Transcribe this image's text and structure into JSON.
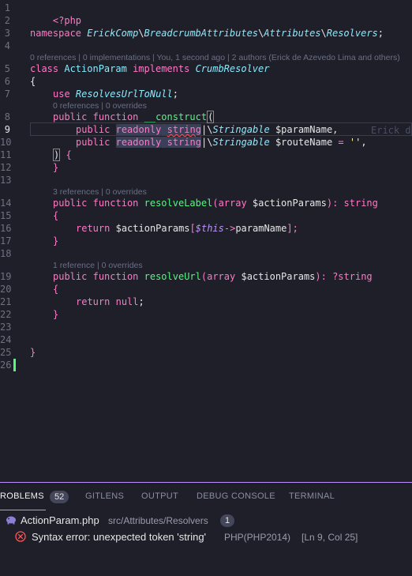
{
  "editor": {
    "active_line": "9",
    "line_numbers": [
      "1",
      "2",
      "3",
      "4",
      "5",
      "6",
      "7",
      "8",
      "9",
      "10",
      "11",
      "12",
      "13",
      "14",
      "15",
      "16",
      "17",
      "18",
      "19",
      "20",
      "21",
      "22",
      "23",
      "24",
      "25",
      "26"
    ],
    "code": {
      "l1_open": "<?php",
      "l3_namespace_kw": "namespace",
      "l3_ns1": "ErickComp",
      "l3_sep": "\\",
      "l3_ns2": "BreadcrumbAttributes",
      "l3_ns3": "Attributes",
      "l3_ns4": "Resolvers",
      "l3_end": ";",
      "l5_class_kw": "class",
      "l5_class_name": "ActionParam",
      "l5_implements_kw": "implements",
      "l5_iface": "CrumbResolver",
      "l6_brace": "{",
      "l7_use_kw": "use",
      "l7_trait": "ResolvesUrlToNull",
      "l7_end": ";",
      "l8_public": "public",
      "l8_function": "function",
      "l8_name": "__construct",
      "l8_paren": "(",
      "l9_public": "public",
      "l9_readonly": "readonly",
      "l9_string": "string",
      "l9_pipe": "|",
      "l9_stringable": "Stringable",
      "l9_var": "$paramName,",
      "l10_public": "public",
      "l10_readonly": "readonly",
      "l10_string": "string",
      "l10_pipe": "|",
      "l10_stringable": "Stringable",
      "l10_var": "$routeName",
      "l10_eq": "=",
      "l10_str": "''",
      "l10_comma": ",",
      "l11_close": ")",
      "l11_brace": "{",
      "l12_brace": "}",
      "l14_public": "public",
      "l14_function": "function",
      "l14_name": "resolveLabel",
      "l14_open": "(",
      "l14_type": "array",
      "l14_var": "$actionParams",
      "l14_close": "):",
      "l14_ret": "string",
      "l15_brace": "{",
      "l16_return": "return",
      "l16_var": "$actionParams",
      "l16_lbr": "[",
      "l16_this": "$this",
      "l16_arrow": "->",
      "l16_prop": "paramName",
      "l16_rbr": "];",
      "l17_brace": "}",
      "l19_public": "public",
      "l19_function": "function",
      "l19_name": "resolveUrl",
      "l19_open": "(",
      "l19_type": "array",
      "l19_var": "$actionParams",
      "l19_close": "):",
      "l19_ret": "?string",
      "l20_brace": "{",
      "l21_return": "return",
      "l21_null": "null",
      "l21_end": ";",
      "l22_brace": "}",
      "l25_brace": "}"
    },
    "codelens": {
      "class_lens": "0 references | 0 implementations | You, 1 second ago | 2 authors (Erick de Azevedo Lima and others)",
      "construct_lens": "0 references | 0 overrides",
      "resolve_label_lens": "3 references | 0 overrides",
      "resolve_url_lens": "1 reference | 0 overrides"
    },
    "blame_ghost": "Erick d"
  },
  "panel": {
    "tabs": [
      {
        "label": "ROBLEMS",
        "active": true
      },
      {
        "label": "GITLENS",
        "active": false
      },
      {
        "label": "OUTPUT",
        "active": false
      },
      {
        "label": "DEBUG CONSOLE",
        "active": false
      },
      {
        "label": "TERMINAL",
        "active": false
      }
    ],
    "problems_count": "52",
    "file": {
      "name": "ActionParam.php",
      "path": "src/Attributes/Resolvers",
      "count": "1"
    },
    "error": {
      "message": "Syntax error: unexpected token 'string'",
      "source": "PHP(PHP2014)",
      "position": "[Ln 9, Col 25]"
    }
  },
  "colors": {
    "background": "#1e1f29",
    "keyword": "#ff79c6",
    "class": "#8be9fd",
    "function": "#50fa7b",
    "string": "#f1fa8c",
    "this": "#bd93f9",
    "error": "#ff5555",
    "accent": "#bd93f9"
  },
  "icons": {
    "file_icon": "php-elephant-icon",
    "error_icon": "error-circle-icon"
  }
}
